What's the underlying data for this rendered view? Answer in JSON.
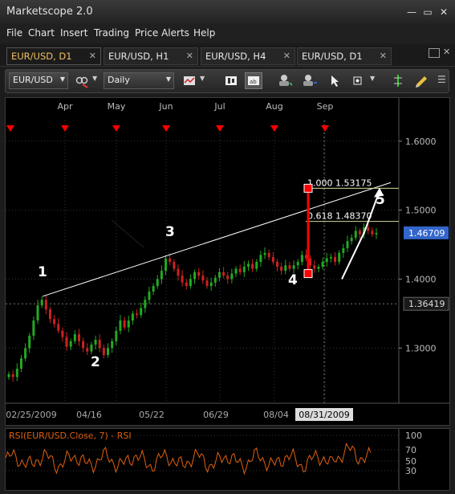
{
  "app": {
    "title": "Marketscope 2.0",
    "minimize": "—",
    "restore": "▭",
    "close": "✕"
  },
  "menu": [
    "File",
    "Chart",
    "Insert",
    "Trading",
    "Price Alerts",
    "Help"
  ],
  "tabs": [
    {
      "label": "EUR/USD, D1",
      "active": true
    },
    {
      "label": "EUR/USD, H1",
      "active": false
    },
    {
      "label": "EUR/USD, H4",
      "active": false
    },
    {
      "label": "EUR/USD, D1",
      "active": false
    }
  ],
  "toolbar": {
    "symbol": "EUR/USD",
    "period": "Daily"
  },
  "chart": {
    "month_labels": [
      "Apr",
      "May",
      "Jun",
      "Jul",
      "Aug",
      "Sep"
    ],
    "price_ticks": [
      "1.6000",
      "1.5000",
      "1.4000",
      "1.3000"
    ],
    "current_price": "1.46709",
    "crosshair_price": "1.36419",
    "date_labels": [
      "02/25/2009",
      "04/16",
      "05/22",
      "06/29",
      "08/04"
    ],
    "crosshair_date": "08/31/2009",
    "fib_labels": [
      "1.000 1.53175",
      "0.618 1.48370"
    ],
    "wave_labels": [
      "1",
      "2",
      "3",
      "4",
      "5"
    ],
    "accent_color": "#ff0000",
    "up_color": "#22aa22",
    "down_color": "#cc2222",
    "price_label_color": "#3366cc"
  },
  "rsi": {
    "title": "RSI(EUR/USD.Close, 7) - RSI",
    "levels": [
      "100",
      "70",
      "50",
      "30"
    ],
    "line_color": "#e06010"
  },
  "chart_data": {
    "type": "candlestick",
    "instrument": "EUR/USD",
    "timeframe": "D1",
    "x_labels": [
      "02/25/2009",
      "04/16",
      "05/22",
      "06/29",
      "08/04",
      "08/31/2009"
    ],
    "y_ticks": [
      1.3,
      1.4,
      1.5,
      1.6
    ],
    "ylim": [
      1.22,
      1.63
    ],
    "last_price": 1.46709,
    "crosshair_price": 1.36419,
    "close_series": [
      1.262,
      1.258,
      1.27,
      1.285,
      1.3,
      1.318,
      1.34,
      1.362,
      1.37,
      1.356,
      1.342,
      1.335,
      1.325,
      1.316,
      1.302,
      1.31,
      1.32,
      1.31,
      1.3,
      1.295,
      1.305,
      1.312,
      1.3,
      1.29,
      1.3,
      1.31,
      1.325,
      1.34,
      1.33,
      1.34,
      1.35,
      1.348,
      1.358,
      1.37,
      1.382,
      1.39,
      1.4,
      1.412,
      1.43,
      1.425,
      1.415,
      1.405,
      1.395,
      1.39,
      1.4,
      1.41,
      1.405,
      1.398,
      1.39,
      1.395,
      1.402,
      1.41,
      1.405,
      1.4,
      1.408,
      1.415,
      1.41,
      1.418,
      1.422,
      1.415,
      1.425,
      1.435,
      1.438,
      1.432,
      1.425,
      1.418,
      1.412,
      1.42,
      1.415,
      1.42,
      1.425,
      1.435,
      1.43,
      1.42,
      1.415,
      1.418,
      1.425,
      1.43,
      1.432,
      1.425,
      1.438,
      1.445,
      1.455,
      1.46,
      1.47,
      1.465,
      1.475,
      1.47,
      1.465,
      1.467
    ],
    "trendline": {
      "from": {
        "x": "02/25/2009",
        "y": 1.375
      },
      "to": {
        "x": "09/2009",
        "y": 1.54
      }
    },
    "fibonacci": [
      {
        "level": 1.0,
        "price": 1.53175
      },
      {
        "level": 0.618,
        "price": 1.4837
      }
    ],
    "waves": [
      "1",
      "2",
      "3",
      "4",
      "5"
    ],
    "rsi_levels": [
      100,
      70,
      50,
      30
    ]
  }
}
